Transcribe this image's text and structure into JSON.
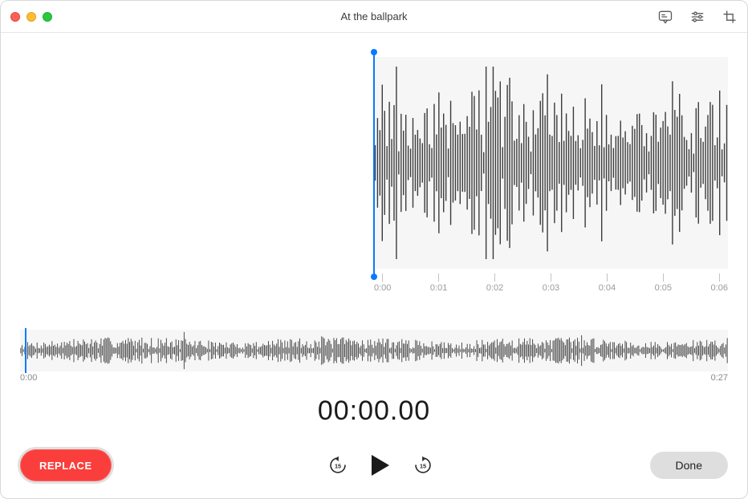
{
  "window": {
    "title": "At the ballpark"
  },
  "toolbar": {
    "transcript_icon": "transcript-icon",
    "settings_icon": "settings-icon",
    "trim_icon": "trim-icon"
  },
  "detail_waveform": {
    "ticks": [
      "0:00",
      "0:01",
      "0:02",
      "0:03",
      "0:04",
      "0:05",
      "0:06"
    ]
  },
  "overview": {
    "start_label": "0:00",
    "end_label": "0:27"
  },
  "timer": {
    "display": "00:00.00"
  },
  "controls": {
    "replace_label": "REPLACE",
    "skip_back_seconds": "15",
    "skip_forward_seconds": "15",
    "done_label": "Done"
  }
}
